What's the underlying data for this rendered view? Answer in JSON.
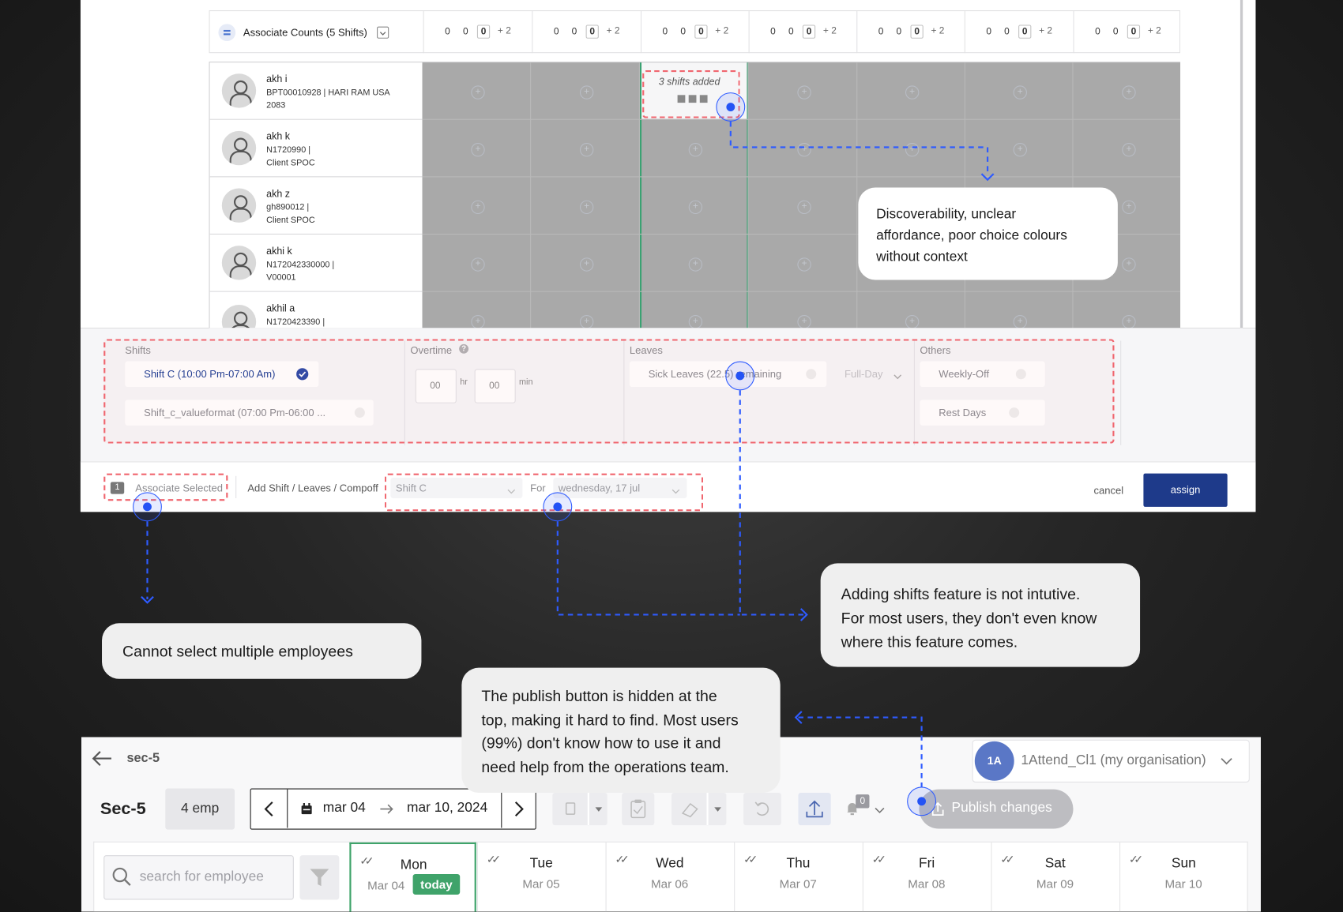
{
  "schedule": {
    "associate_counts_label": "Associate Counts (5 Shifts)",
    "counts_cell": {
      "v1": "0",
      "v2": "0",
      "v3": "0",
      "more": "+ 2"
    },
    "shifts_added_label": "3 shifts added",
    "employees": [
      {
        "name": "akh i",
        "line1": "BPT00010928 | HARI RAM USA",
        "line2": "2083"
      },
      {
        "name": "akh k",
        "line1": "N1720990 |",
        "line2": "Client SPOC"
      },
      {
        "name": "akh z",
        "line1": "gh890012 |",
        "line2": "Client SPOC"
      },
      {
        "name": "akhi k",
        "line1": "N172042330000 |",
        "line2": "V00001"
      },
      {
        "name": "akhil a",
        "line1": "N1720423390 |",
        "line2": ""
      }
    ]
  },
  "assign_panel": {
    "shifts_title": "Shifts",
    "shift_option_1": "Shift C (10:00 Pm-07:00 Am)",
    "shift_option_2": "Shift_c_valueformat (07:00 Pm-06:00 ...",
    "overtime_title": "Overtime",
    "hr_value": "00",
    "hr_label": "hr",
    "min_value": "00",
    "min_label": "min",
    "leaves_title": "Leaves",
    "leave_option": "Sick Leaves (22.5) remaining",
    "leave_duration": "Full-Day",
    "others_title": "Others",
    "other_option_1": "Weekly-Off",
    "other_option_2": "Rest Days",
    "selected_count": "1",
    "associate_selected_label": "Associate Selected",
    "add_label": "Add Shift / Leaves / Compoff",
    "shift_select_value": "Shift C",
    "for_label": "For",
    "date_select_value": "wednesday, 17 jul",
    "cancel_label": "cancel",
    "assign_label": "assign"
  },
  "annotations": {
    "discoverability": [
      "Discoverability,  unclear",
      "affordance, poor choice colours",
      "without context"
    ],
    "adding_shifts": [
      "Adding shifts feature is not intutive.",
      "For most users, they don't even know",
      "where this feature comes."
    ],
    "multi_select": "Cannot select multiple employees",
    "publish_hidden": [
      "The publish button is hidden at the",
      "top, making it hard to find. Most users",
      "(99%) don't know how to use it and",
      "need help from the operations team."
    ]
  },
  "roster": {
    "breadcrumb": "sec-5",
    "org_initials": "1A",
    "org_name": "1Attend_Cl1 (my organisation)",
    "team_name": "Sec-5",
    "emp_count": "4 emp",
    "date_from": "mar 04",
    "date_to": "mar 10, 2024",
    "notif_count": "0",
    "publish_label": "Publish changes",
    "search_placeholder": "search for employee",
    "today_label": "today",
    "days": [
      {
        "name": "Mon",
        "date": "Mar 04"
      },
      {
        "name": "Tue",
        "date": "Mar 05"
      },
      {
        "name": "Wed",
        "date": "Mar 06"
      },
      {
        "name": "Thu",
        "date": "Mar 07"
      },
      {
        "name": "Fri",
        "date": "Mar 08"
      },
      {
        "name": "Sat",
        "date": "Mar 09"
      },
      {
        "name": "Sun",
        "date": "Mar 10"
      }
    ]
  },
  "colors": {
    "accent": "#1e3a8a",
    "highlight": "#2e5bff",
    "dash": "#f0666f",
    "today": "#3fa36a",
    "grid": "#a9a9a9"
  }
}
